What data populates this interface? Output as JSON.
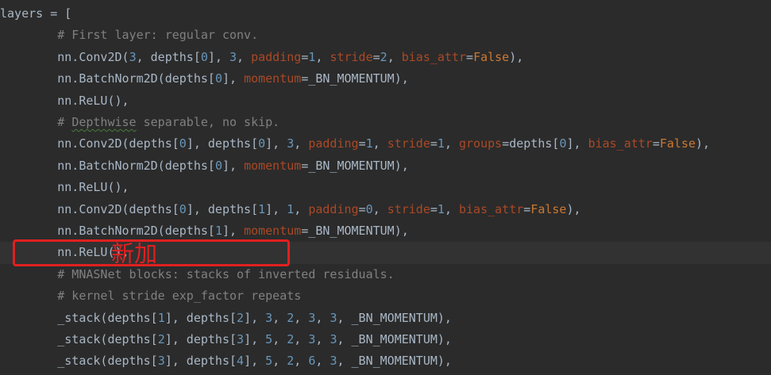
{
  "lines": [
    {
      "indent": "",
      "tokens": [
        [
          "layers = [",
          "default"
        ]
      ]
    },
    {
      "indent": "    ",
      "tokens": [
        [
          "# First layer: regular conv.",
          "comment"
        ]
      ]
    },
    {
      "indent": "    ",
      "tokens": [
        [
          "nn.Conv2D(",
          "default"
        ],
        [
          "3",
          "num"
        ],
        [
          ", depths[",
          "default"
        ],
        [
          "0",
          "num"
        ],
        [
          "], ",
          "default"
        ],
        [
          "3",
          "num"
        ],
        [
          ", ",
          "default"
        ],
        [
          "padding",
          "param"
        ],
        [
          "=",
          "eq"
        ],
        [
          "1",
          "num"
        ],
        [
          ", ",
          "default"
        ],
        [
          "stride",
          "param"
        ],
        [
          "=",
          "eq"
        ],
        [
          "2",
          "num"
        ],
        [
          ", ",
          "default"
        ],
        [
          "bias_attr",
          "param"
        ],
        [
          "=",
          "eq"
        ],
        [
          "False",
          "kw"
        ],
        [
          "),",
          "default"
        ]
      ]
    },
    {
      "indent": "    ",
      "tokens": [
        [
          "nn.BatchNorm2D(depths[",
          "default"
        ],
        [
          "0",
          "num"
        ],
        [
          "], ",
          "default"
        ],
        [
          "momentum",
          "param"
        ],
        [
          "=",
          "eq"
        ],
        [
          "_BN_MOMENTUM),",
          "default"
        ]
      ]
    },
    {
      "indent": "    ",
      "tokens": [
        [
          "nn.ReLU(),",
          "default"
        ]
      ]
    },
    {
      "indent": "    ",
      "tokens": [
        [
          "# ",
          "comment"
        ],
        [
          "Depthwise",
          "typo"
        ],
        [
          " separable, no skip.",
          "comment"
        ]
      ]
    },
    {
      "indent": "    ",
      "tokens": [
        [
          "nn.Conv2D(depths[",
          "default"
        ],
        [
          "0",
          "num"
        ],
        [
          "], depths[",
          "default"
        ],
        [
          "0",
          "num"
        ],
        [
          "], ",
          "default"
        ],
        [
          "3",
          "num"
        ],
        [
          ", ",
          "default"
        ],
        [
          "padding",
          "param"
        ],
        [
          "=",
          "eq"
        ],
        [
          "1",
          "num"
        ],
        [
          ", ",
          "default"
        ],
        [
          "stride",
          "param"
        ],
        [
          "=",
          "eq"
        ],
        [
          "1",
          "num"
        ],
        [
          ", ",
          "default"
        ],
        [
          "groups",
          "param"
        ],
        [
          "=",
          "eq"
        ],
        [
          "depths[",
          "default"
        ],
        [
          "0",
          "num"
        ],
        [
          "], ",
          "default"
        ],
        [
          "bias_attr",
          "param"
        ],
        [
          "=",
          "eq"
        ],
        [
          "False",
          "kw"
        ],
        [
          "),",
          "default"
        ]
      ]
    },
    {
      "indent": "    ",
      "tokens": [
        [
          "nn.BatchNorm2D(depths[",
          "default"
        ],
        [
          "0",
          "num"
        ],
        [
          "], ",
          "default"
        ],
        [
          "momentum",
          "param"
        ],
        [
          "=",
          "eq"
        ],
        [
          "_BN_MOMENTUM),",
          "default"
        ]
      ]
    },
    {
      "indent": "    ",
      "tokens": [
        [
          "nn.ReLU(),",
          "default"
        ]
      ]
    },
    {
      "indent": "    ",
      "tokens": [
        [
          "nn.Conv2D(depths[",
          "default"
        ],
        [
          "0",
          "num"
        ],
        [
          "], depths[",
          "default"
        ],
        [
          "1",
          "num"
        ],
        [
          "], ",
          "default"
        ],
        [
          "1",
          "num"
        ],
        [
          ", ",
          "default"
        ],
        [
          "padding",
          "param"
        ],
        [
          "=",
          "eq"
        ],
        [
          "0",
          "num"
        ],
        [
          ", ",
          "default"
        ],
        [
          "stride",
          "param"
        ],
        [
          "=",
          "eq"
        ],
        [
          "1",
          "num"
        ],
        [
          ", ",
          "default"
        ],
        [
          "bias_attr",
          "param"
        ],
        [
          "=",
          "eq"
        ],
        [
          "False",
          "kw"
        ],
        [
          "),",
          "default"
        ]
      ]
    },
    {
      "indent": "    ",
      "tokens": [
        [
          "nn.BatchNorm2D(depths[",
          "default"
        ],
        [
          "1",
          "num"
        ],
        [
          "], ",
          "default"
        ],
        [
          "momentum",
          "param"
        ],
        [
          "=",
          "eq"
        ],
        [
          "_BN_MOMENTUM),",
          "default"
        ]
      ]
    },
    {
      "indent": "    ",
      "tokens": [
        [
          "nn.ReLU(),",
          "default"
        ]
      ],
      "current": true
    },
    {
      "indent": "    ",
      "tokens": [
        [
          "# MNASNet blocks: stacks of inverted residuals.",
          "comment"
        ]
      ]
    },
    {
      "indent": "    ",
      "tokens": [
        [
          "# kernel stride exp_factor repeats",
          "comment"
        ]
      ]
    },
    {
      "indent": "    ",
      "tokens": [
        [
          "_stack(depths[",
          "default"
        ],
        [
          "1",
          "num"
        ],
        [
          "], depths[",
          "default"
        ],
        [
          "2",
          "num"
        ],
        [
          "], ",
          "default"
        ],
        [
          "3",
          "num"
        ],
        [
          ", ",
          "default"
        ],
        [
          "2",
          "num"
        ],
        [
          ", ",
          "default"
        ],
        [
          "3",
          "num"
        ],
        [
          ", ",
          "default"
        ],
        [
          "3",
          "num"
        ],
        [
          ", _BN_MOMENTUM),",
          "default"
        ]
      ]
    },
    {
      "indent": "    ",
      "tokens": [
        [
          "_stack(depths[",
          "default"
        ],
        [
          "2",
          "num"
        ],
        [
          "], depths[",
          "default"
        ],
        [
          "3",
          "num"
        ],
        [
          "], ",
          "default"
        ],
        [
          "5",
          "num"
        ],
        [
          ", ",
          "default"
        ],
        [
          "2",
          "num"
        ],
        [
          ", ",
          "default"
        ],
        [
          "3",
          "num"
        ],
        [
          ", ",
          "default"
        ],
        [
          "3",
          "num"
        ],
        [
          ", _BN_MOMENTUM),",
          "default"
        ]
      ]
    },
    {
      "indent": "    ",
      "tokens": [
        [
          "_stack(depths[",
          "default"
        ],
        [
          "3",
          "num"
        ],
        [
          "], depths[",
          "default"
        ],
        [
          "4",
          "num"
        ],
        [
          "], ",
          "default"
        ],
        [
          "5",
          "num"
        ],
        [
          ", ",
          "default"
        ],
        [
          "2",
          "num"
        ],
        [
          ", ",
          "default"
        ],
        [
          "6",
          "num"
        ],
        [
          ", ",
          "default"
        ],
        [
          "3",
          "num"
        ],
        [
          ", _BN_MOMENTUM),",
          "default"
        ]
      ]
    }
  ],
  "annotation": {
    "text": "新加",
    "color": "#e02020"
  },
  "colors": {
    "background": "#2b2b2b",
    "current_line": "#323232",
    "default": "#a9b7c6",
    "comment": "#808080",
    "number": "#6897bb",
    "keyword": "#cc7832",
    "parameter": "#aa4926"
  }
}
